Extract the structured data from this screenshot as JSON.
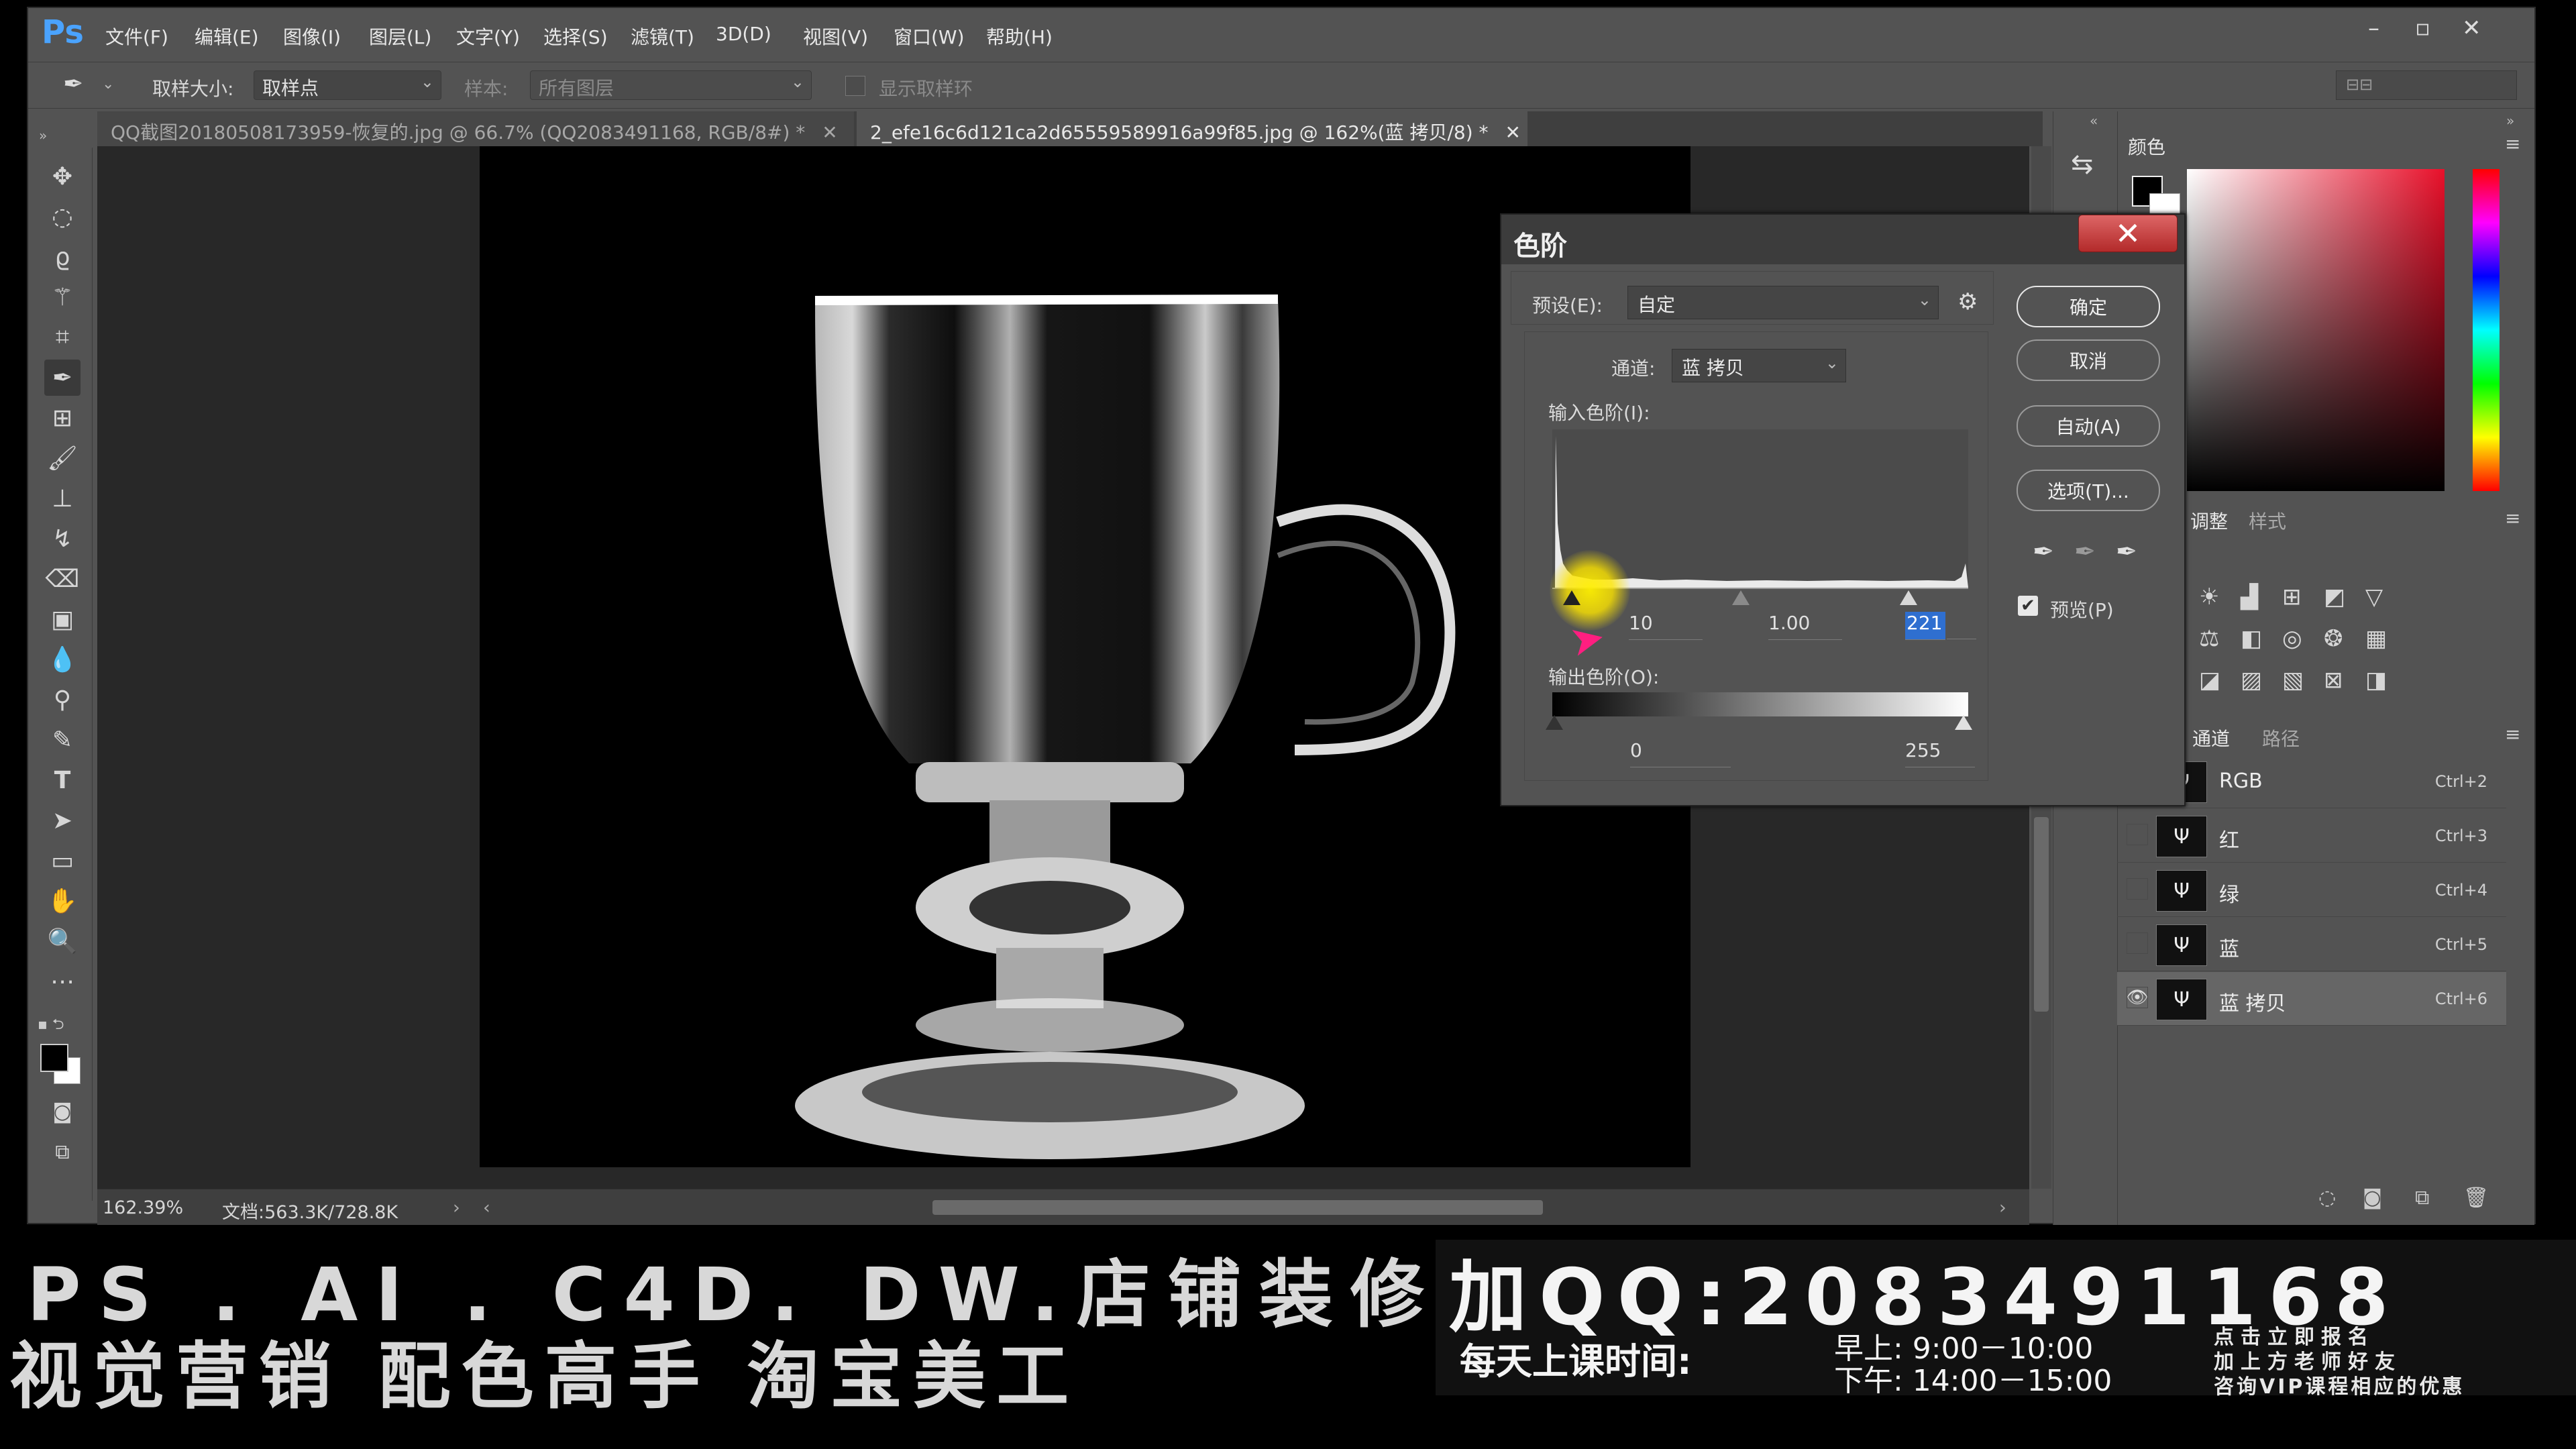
{
  "app": {
    "logo": "Ps"
  },
  "menu": [
    "文件(F)",
    "编辑(E)",
    "图像(I)",
    "图层(L)",
    "文字(Y)",
    "选择(S)",
    "滤镜(T)",
    "3D(D)",
    "视图(V)",
    "窗口(W)",
    "帮助(H)"
  ],
  "options": {
    "sample_size_label": "取样大小:",
    "sample_size_value": "取样点",
    "sample_label": "样本:",
    "sample_value": "所有图层",
    "show_ring_label": "显示取样环"
  },
  "tabs": [
    {
      "label": "QQ截图20180508173959-恢复的.jpg @ 66.7% (QQ2083491168, RGB/8#) *"
    },
    {
      "label": "2_efe16c6d121ca2d65559589916a99f85.jpg  @ 162%(蓝 拷贝/8) *"
    }
  ],
  "status": {
    "zoom": "162.39%",
    "doc": "文档:563.3K/728.8K"
  },
  "panels": {
    "color_tab": "颜色",
    "adjust_tab": "调整",
    "style_tab": "样式",
    "channels_tab": "通道",
    "paths_tab": "路径"
  },
  "channels": [
    {
      "name": "RGB",
      "key": "Ctrl+2",
      "visible": false
    },
    {
      "name": "红",
      "key": "Ctrl+3",
      "visible": false
    },
    {
      "name": "绿",
      "key": "Ctrl+4",
      "visible": false
    },
    {
      "name": "蓝",
      "key": "Ctrl+5",
      "visible": false
    },
    {
      "name": "蓝 拷贝",
      "key": "Ctrl+6",
      "visible": true
    }
  ],
  "levels": {
    "title": "色阶",
    "preset_label": "预设(E):",
    "preset_value": "自定",
    "channel_label": "通道:",
    "channel_value": "蓝 拷贝",
    "input_label": "输入色阶(I):",
    "input_black": "10",
    "input_gamma": "1.00",
    "input_white": "221",
    "output_label": "输出色阶(O):",
    "output_black": "0",
    "output_white": "255",
    "ok": "确定",
    "cancel": "取消",
    "auto": "自动(A)",
    "options": "选项(T)...",
    "preview_label": "预览(P)",
    "preview_checked": true
  },
  "banner": {
    "line1": "PS . AI . C4D. DW.店铺装修",
    "line2": "视觉营销  配色高手  淘宝美工",
    "qq": "加QQ:2083491168",
    "class_label": "每天上课时间:",
    "morning": "早上: 9:00－10:00",
    "afternoon": "下午: 14:00－15:00",
    "note1": "点击立即报名",
    "note2": "加上方老师好友",
    "note3": "咨询VIP课程相应的优惠"
  }
}
